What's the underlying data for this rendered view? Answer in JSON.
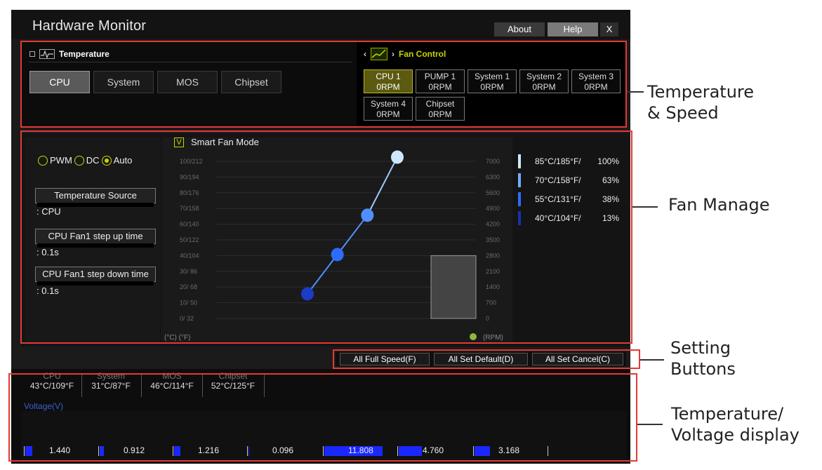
{
  "window": {
    "title": "Hardware Monitor",
    "buttons": {
      "about": "About",
      "help": "Help",
      "close": "X"
    }
  },
  "temperature": {
    "heading": "Temperature",
    "tabs": [
      {
        "label": "CPU",
        "active": true
      },
      {
        "label": "System",
        "active": false
      },
      {
        "label": "MOS",
        "active": false
      },
      {
        "label": "Chipset",
        "active": false
      }
    ]
  },
  "fan_control": {
    "heading": "Fan Control",
    "fans": [
      {
        "name": "CPU 1",
        "rpm": "0RPM",
        "active": true
      },
      {
        "name": "PUMP 1",
        "rpm": "0RPM",
        "active": false
      },
      {
        "name": "System 1",
        "rpm": "0RPM",
        "active": false
      },
      {
        "name": "System 2",
        "rpm": "0RPM",
        "active": false
      },
      {
        "name": "System 3",
        "rpm": "0RPM",
        "active": false
      },
      {
        "name": "System 4",
        "rpm": "0RPM",
        "active": false
      },
      {
        "name": "Chipset",
        "rpm": "0RPM",
        "active": false
      }
    ]
  },
  "fan_manage": {
    "modes": {
      "pwm": "PWM",
      "dc": "DC",
      "auto": "Auto",
      "selected": "Auto"
    },
    "temperature_source_label": "Temperature Source",
    "temperature_source_value": ": CPU",
    "step_up_label": "CPU Fan1 step up time",
    "step_up_value": ": 0.1s",
    "step_down_label": "CPU Fan1 step down time",
    "step_down_value": ": 0.1s",
    "smart_fan_label": "Smart Fan Mode",
    "smart_fan_checked": true,
    "smart_fan_check_glyph": "V",
    "legend": [
      {
        "temp": "85°C/185°F/",
        "pct": "100%",
        "color": "#cfe6ff"
      },
      {
        "temp": "70°C/158°F/",
        "pct": "63%",
        "color": "#6fb0ff"
      },
      {
        "temp": "55°C/131°F/",
        "pct": "38%",
        "color": "#2e6cff"
      },
      {
        "temp": "40°C/104°F/",
        "pct": "13%",
        "color": "#1a2fb0"
      }
    ]
  },
  "chart_data": {
    "type": "line",
    "left_axis_ticks": [
      "100/212",
      "90/194",
      "80/176",
      "70/158",
      "60/140",
      "50/122",
      "40/104",
      "30/ 86",
      "20/ 68",
      "10/ 50",
      "0/ 32"
    ],
    "right_axis_ticks": [
      "7000",
      "6300",
      "5600",
      "4900",
      "4200",
      "3500",
      "2800",
      "2100",
      "1400",
      "700",
      "0"
    ],
    "x_unit_label": "(°C) (°F)",
    "y_unit_label": "(RPM)",
    "points": [
      {
        "temp_c": 40,
        "pct": 13
      },
      {
        "temp_c": 55,
        "pct": 38
      },
      {
        "temp_c": 70,
        "pct": 63
      },
      {
        "temp_c": 85,
        "pct": 100
      }
    ],
    "current_rpm_bar_value": 2800
  },
  "setting_buttons": {
    "full_speed": "All Full Speed(F)",
    "set_default": "All Set Default(D)",
    "set_cancel": "All Set Cancel(C)"
  },
  "temp_display": [
    {
      "name": "CPU",
      "value": "43°C/109°F"
    },
    {
      "name": "System",
      "value": "31°C/87°F"
    },
    {
      "name": "MOS",
      "value": "46°C/114°F"
    },
    {
      "name": "Chipset",
      "value": "52°C/125°F"
    }
  ],
  "voltage": {
    "title": "Voltage(V)",
    "values": [
      "1.440",
      "0.912",
      "1.216",
      "0.096",
      "11.808",
      "4.760",
      "3.168"
    ]
  },
  "callouts": {
    "temp_speed_1": "Temperature",
    "temp_speed_2": "& Speed",
    "fan_manage": "Fan Manage",
    "setting_1": "Setting",
    "setting_2": "Buttons",
    "temp_volt_1": "Temperature/",
    "temp_volt_2": "Voltage display"
  }
}
